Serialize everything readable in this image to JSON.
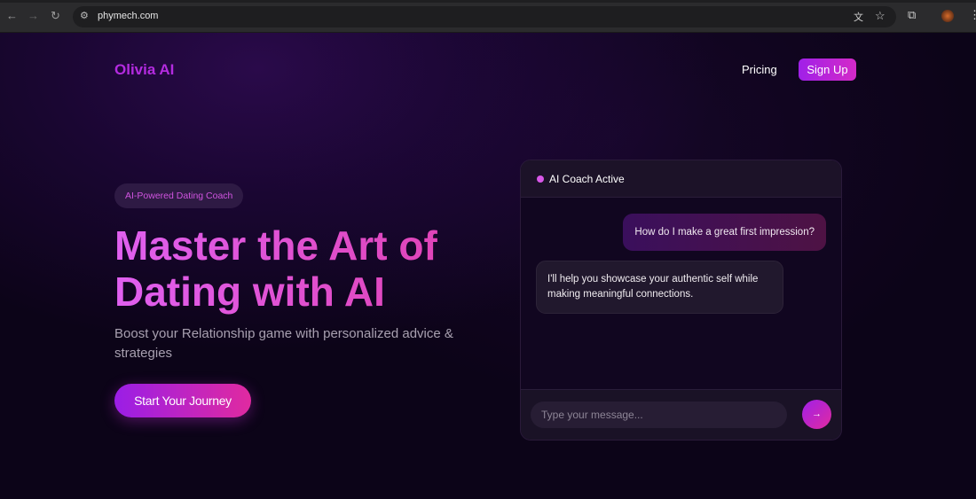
{
  "browser": {
    "url": "phymech.com"
  },
  "nav": {
    "logo": "Olivia AI",
    "pricing": "Pricing",
    "signup": "Sign Up"
  },
  "hero": {
    "badge": "AI-Powered Dating Coach",
    "title_line1": "Master the Art of",
    "title_line2": "Dating with AI",
    "subtitle": "Boost your Relationship game with personalized advice & strategies",
    "cta": "Start Your Journey"
  },
  "chat": {
    "status": "AI Coach Active",
    "messages": [
      {
        "role": "user",
        "text": "How do I make a great first impression?"
      },
      {
        "role": "ai",
        "text": "I'll help you showcase your authentic self while making meaningful connections."
      }
    ],
    "placeholder": "Type your message...",
    "send_icon": "→"
  },
  "colors": {
    "accent": "#b42be0",
    "pink": "#e02aa0",
    "bg": "#0c0418"
  }
}
